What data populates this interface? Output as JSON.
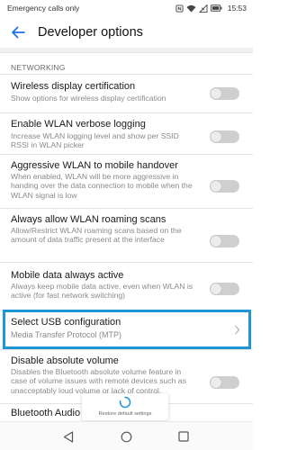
{
  "status_bar": {
    "carrier_text": "Emergency calls only",
    "time": "15:53"
  },
  "app_bar": {
    "back_icon": "arrow-left-icon",
    "title": "Developer options"
  },
  "section": {
    "header": "NETWORKING"
  },
  "settings": [
    {
      "title": "Wireless display certification",
      "summary": "Show options for wireless display certification",
      "control": "toggle",
      "checked": false
    },
    {
      "title": "Enable WLAN verbose logging",
      "summary": "Increase WLAN logging level and show per SSID RSSI in WLAN picker",
      "control": "toggle",
      "checked": false
    },
    {
      "title": "Aggressive WLAN to mobile handover",
      "summary": "When enabled, WLAN will be more aggressive in handing over the data connection to mobile when the WLAN signal is low",
      "control": "toggle",
      "checked": false
    },
    {
      "title": "Always allow WLAN roaming scans",
      "summary": "Allow/Restrict WLAN roaming scans based on the amount of data traffic present at the interface",
      "control": "toggle",
      "checked": false
    },
    {
      "title": "Mobile data always active",
      "summary": "Always keep mobile data active, even when WLAN is active (for fast network switching)",
      "control": "toggle",
      "checked": false
    },
    {
      "title": "Select USB configuration",
      "summary": "Media Transfer Protocol (MTP)",
      "control": "chevron",
      "highlighted": true
    },
    {
      "title": "Disable absolute volume",
      "summary": "Disables the Bluetooth absolute volume feature in case of volume issues with remote devices such as unacceptably loud volume or lack of control.",
      "control": "toggle",
      "checked": false
    },
    {
      "title": "Bluetooth Audio Codec",
      "summary": "",
      "control": "none"
    }
  ],
  "restore_button": {
    "label": "Restore default settings",
    "icon": "refresh-spinner-icon"
  },
  "nav_bar": {
    "back_icon": "nav-back-triangle-icon",
    "home_icon": "nav-home-circle-icon",
    "recents_icon": "nav-recents-square-icon"
  },
  "colors": {
    "highlight_border": "#1f96d6",
    "toggle_off_track": "#cfcfcf",
    "accent": "#1a73e8"
  }
}
